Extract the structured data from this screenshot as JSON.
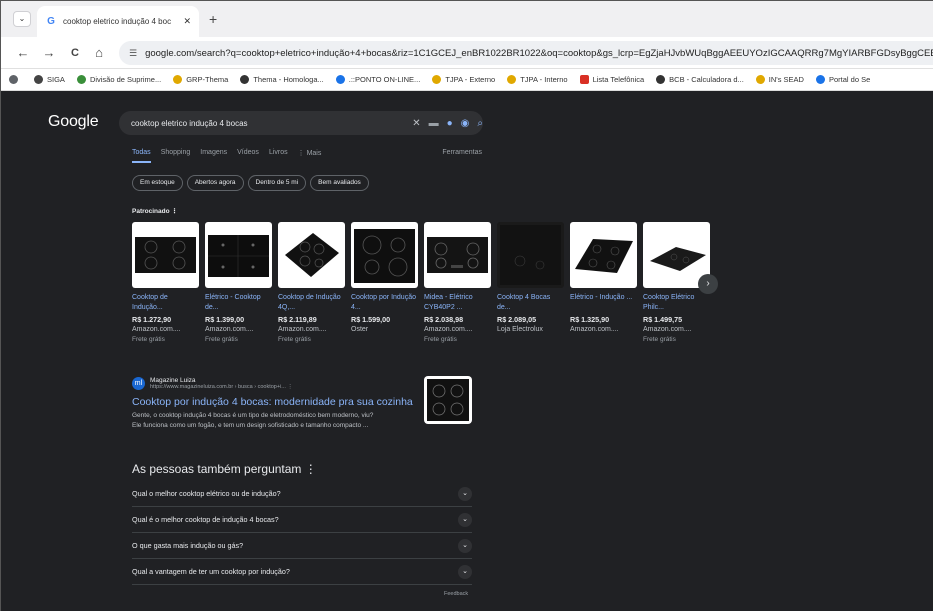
{
  "browser": {
    "tab_menu": "⌄",
    "tab_title": "cooktop eletrico indução 4 boc",
    "tab_close": "✕",
    "new_tab": "+",
    "nav": {
      "back": "←",
      "forward": "→",
      "reload": "C",
      "home": "⌂"
    },
    "url": "google.com/search?q=cooktop+eletrico+indução+4+bocas&riz=1C1GCEJ_enBR1022BR1022&oq=cooktop&gs_lcrp=EgZjaHJvbWUqBggAEEUYOzIGCAAQRRg7MgYIARBFGDsyBggCEEU"
  },
  "bookmarks": [
    {
      "label": "",
      "icon": "circle-icon",
      "color": "#5f6368"
    },
    {
      "label": "SIGA",
      "icon": "siga-icon",
      "color": "#444444"
    },
    {
      "label": "Divisão de Suprime...",
      "icon": "leaf-icon",
      "color": "#3a8f3a"
    },
    {
      "label": "GRP-Thema",
      "icon": "grp-icon",
      "color": "#e0a800"
    },
    {
      "label": "Thema - Homologa...",
      "icon": "globe-icon",
      "color": "#333333"
    },
    {
      "label": ".::PONTO ON-LINE...",
      "icon": "star-icon",
      "color": "#1a73e8"
    },
    {
      "label": "TJPA - Externo",
      "icon": "tjpa-icon",
      "color": "#e0a800"
    },
    {
      "label": "TJPA - Interno",
      "icon": "tjpa-icon",
      "color": "#e0a800"
    },
    {
      "label": "Lista Telefônica",
      "icon": "pdf-icon",
      "color": "#d93025"
    },
    {
      "label": "BCB - Calculadora d...",
      "icon": "globe-icon",
      "color": "#333333"
    },
    {
      "label": "IN's SEAD",
      "icon": "tjpa-icon",
      "color": "#e0a800"
    },
    {
      "label": "Portal do Se",
      "icon": "star-icon",
      "color": "#1a73e8"
    }
  ],
  "google": {
    "logo": "Google",
    "query": "cooktop eletrico indução 4 bocas",
    "tabs": [
      "Todas",
      "Shopping",
      "Imagens",
      "Vídeos",
      "Livros",
      "⋮ Mais"
    ],
    "tools": "Ferramentas",
    "chips": [
      "Em estoque",
      "Abertos agora",
      "Dentro de 5 mi",
      "Bem avaliados"
    ],
    "sponsored": "Patrocinado ⋮",
    "products": [
      {
        "title": "Cooktop de Indução...",
        "price": "R$ 1.272,90",
        "store": "Amazon.com....",
        "shipping": "Frete grátis"
      },
      {
        "title": "Elétrico - Cooktop de...",
        "price": "R$ 1.399,00",
        "store": "Amazon.com....",
        "shipping": "Frete grátis"
      },
      {
        "title": "Cooktop de Indução 4Q,...",
        "price": "R$ 2.119,89",
        "store": "Amazon.com....",
        "shipping": "Frete grátis"
      },
      {
        "title": "Cooktop por Indução 4...",
        "price": "R$ 1.599,00",
        "store": "Oster",
        "shipping": ""
      },
      {
        "title": "Midea - Elétrico CYB40P2 ...",
        "price": "R$ 2.038,98",
        "store": "Amazon.com....",
        "shipping": "Frete grátis"
      },
      {
        "title": "Cooktop 4 Bocas de...",
        "price": "R$ 2.089,05",
        "store": "Loja Electrolux",
        "shipping": ""
      },
      {
        "title": "Elétrico - Indução ...",
        "price": "R$ 1.325,90",
        "store": "Amazon.com....",
        "shipping": ""
      },
      {
        "title": "Cooktop Elétrico Philc...",
        "price": "R$ 1.499,75",
        "store": "Amazon.com....",
        "shipping": "Frete grátis"
      }
    ],
    "result": {
      "site_name": "Magazine Luiza",
      "site_url": "https://www.magazineluiza.com.br › busca › cooktop+i...  ⋮",
      "title": "Cooktop por indução 4 bocas: modernidade pra sua cozinha",
      "snippet_1": "Gente, o cooktop indução 4 bocas é um tipo de eletrodoméstico bem moderno, viu?",
      "snippet_2": "Ele funciona como um fogão, e tem um design sofisticado e tamanho compacto ..."
    },
    "paa_title": "As pessoas também perguntam  ⋮",
    "paa": [
      "Qual o melhor cooktop elétrico ou de indução?",
      "Qual é o melhor cooktop de indução 4 bocas?",
      "O que gasta mais indução ou gás?",
      "Qual a vantagem de ter um cooktop por indução?"
    ],
    "feedback": "Feedback"
  }
}
